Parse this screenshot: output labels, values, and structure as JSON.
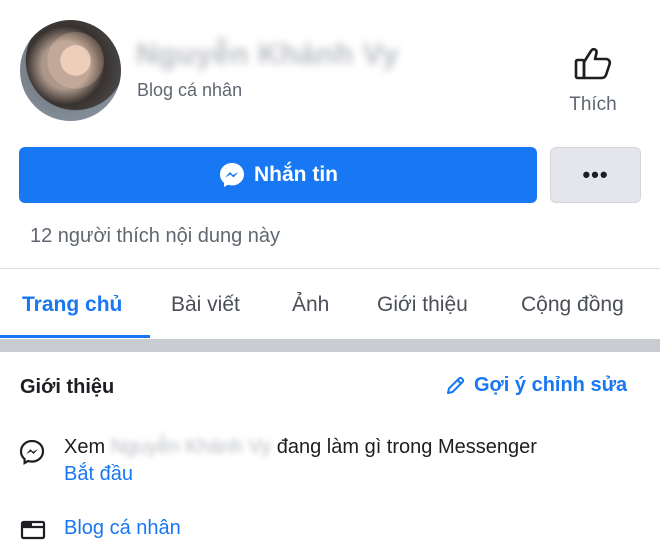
{
  "profile": {
    "name": "Nguyễn Khánh Vy",
    "category": "Blog cá nhân",
    "avatar_icon": "profile-photo"
  },
  "like_action": {
    "label": "Thích",
    "icon": "thumbs-up-icon"
  },
  "actions": {
    "message_label": "Nhắn tin",
    "message_icon": "messenger-icon",
    "more_label": "•••"
  },
  "likes_text": "12 người thích nội dung này",
  "tabs": [
    {
      "label": "Trang chủ",
      "active": true
    },
    {
      "label": "Bài viết",
      "active": false
    },
    {
      "label": "Ảnh",
      "active": false
    },
    {
      "label": "Giới thiệu",
      "active": false
    },
    {
      "label": "Cộng đồng",
      "active": false
    }
  ],
  "about": {
    "title": "Giới thiệu",
    "suggest_edit": "Gợi ý chỉnh sửa",
    "messenger_prefix": "Xem",
    "messenger_name": "Nguyễn Khánh Vy",
    "messenger_suffix": "đang làm gì trong Messenger",
    "messenger_link": "Bắt đầu",
    "category_link": "Blog cá nhân"
  },
  "colors": {
    "accent": "#1877f2",
    "secondary_button": "#e4e6eb",
    "muted_text": "#606770",
    "band": "#c9ccd1"
  }
}
